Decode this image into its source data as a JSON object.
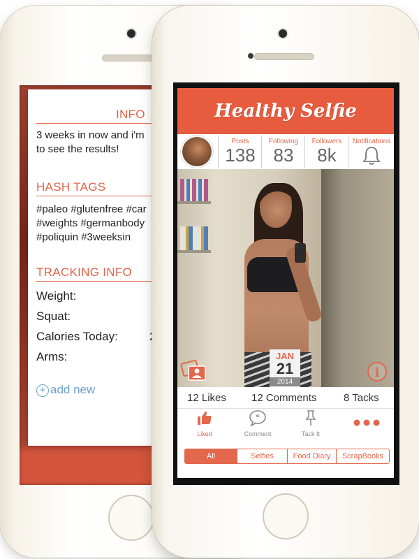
{
  "back_screen": {
    "info_heading": "INFO",
    "info_text_line1": "3 weeks in now and i'm",
    "info_text_line2": "to see the results!",
    "hashtags_heading": "HASH TAGS",
    "hashtags_line1": "#paleo #glutenfree #car",
    "hashtags_line2": "#weights #germanbody",
    "hashtags_line3": "#poliquin #3weeksin",
    "tracking_heading": "TRACKING INFO",
    "tracking_items": [
      "Weight:",
      "Squat:",
      "Calories Today:",
      "Arms:"
    ],
    "calories_value_partial": "2",
    "add_new": "add new"
  },
  "app": {
    "title": "Healthy Selfie",
    "stats": [
      {
        "label": "Posts",
        "value": "138"
      },
      {
        "label": "Following",
        "value": "83"
      },
      {
        "label": "Followers",
        "value": "8k"
      },
      {
        "label": "Notifications",
        "icon": "bell-icon"
      }
    ],
    "date_badge": {
      "month": "JAN",
      "day": "21",
      "year": "2014"
    },
    "counts": {
      "likes": "12 Likes",
      "comments": "12 Comments",
      "tacks": "8 Tacks"
    },
    "actions": [
      {
        "label": "Liked",
        "icon": "thumbs-up-icon",
        "active": true
      },
      {
        "label": "Comment",
        "icon": "speech-bubble-icon",
        "active": false
      },
      {
        "label": "Tack It",
        "icon": "pushpin-icon",
        "active": false
      },
      {
        "label": "",
        "icon": "more-dots-icon",
        "active": false
      }
    ],
    "tabs": [
      "All",
      "Selfies",
      "Food Diary",
      "ScrapBooks"
    ],
    "active_tab": "All"
  },
  "colors": {
    "accent": "#e75b3f",
    "text": "#333333",
    "muted": "#888888"
  }
}
